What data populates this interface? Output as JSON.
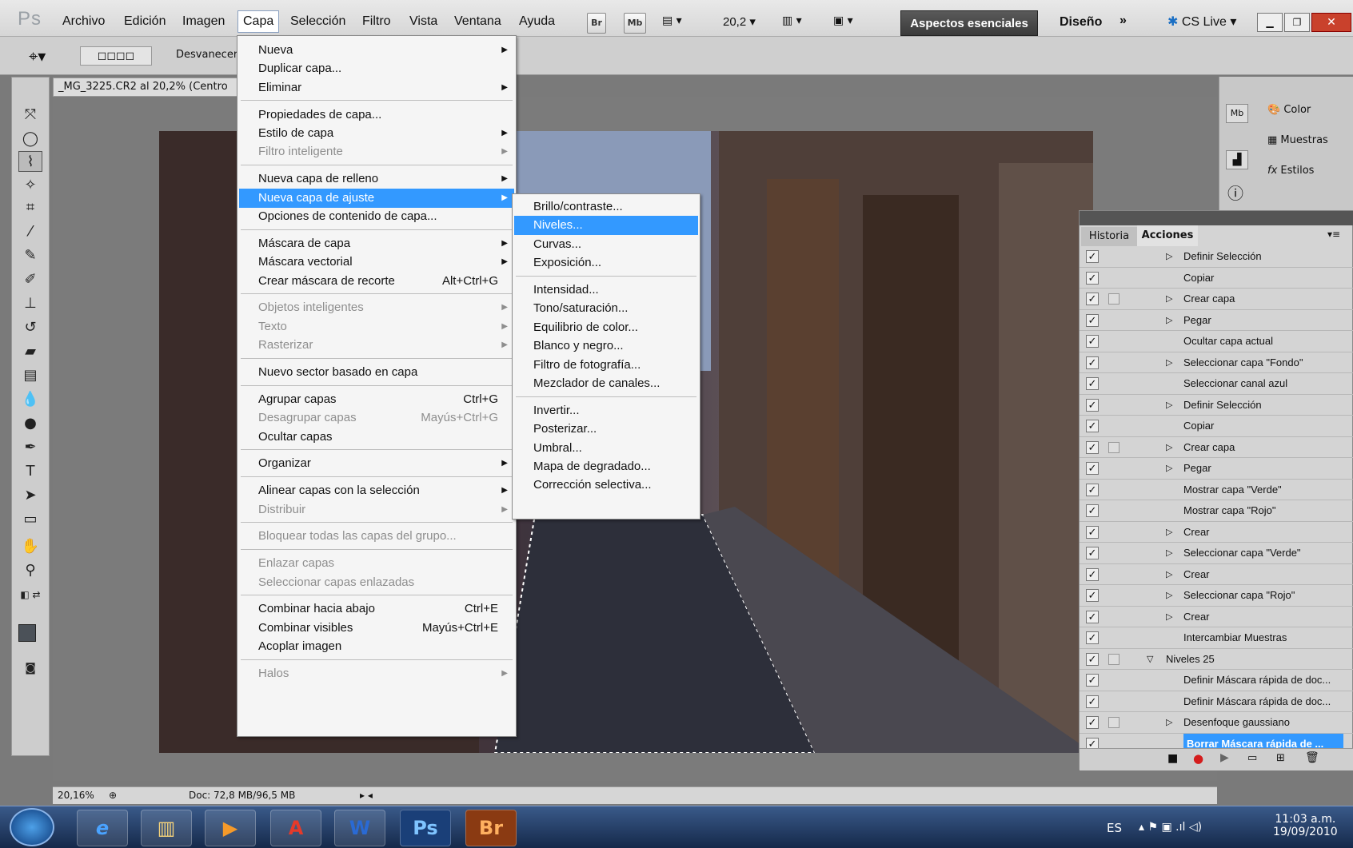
{
  "app": {
    "logo": "Ps"
  },
  "menubar": {
    "items": [
      "Archivo",
      "Edición",
      "Imagen",
      "Capa",
      "Selección",
      "Filtro",
      "Vista",
      "Ventana",
      "Ayuda"
    ],
    "zoom": "20,2",
    "br": "Br",
    "mb": "Mb",
    "workspace": "Aspectos esenciales",
    "design": "Diseño",
    "cslive": "CS Live"
  },
  "options": {
    "label": "Desvanecer:"
  },
  "document": {
    "tab": "_MG_3225.CR2 al 20,2% (Centro",
    "status_zoom": "20,16%",
    "status_doc": "Doc: 72,8 MB/96,5 MB"
  },
  "capa_menu": [
    {
      "label": "Nueva",
      "sub": true
    },
    {
      "label": "Duplicar capa..."
    },
    {
      "label": "Eliminar",
      "sub": true
    },
    {
      "sep": true
    },
    {
      "label": "Propiedades de capa..."
    },
    {
      "label": "Estilo de capa",
      "sub": true
    },
    {
      "label": "Filtro inteligente",
      "sub": true,
      "disabled": true
    },
    {
      "sep": true
    },
    {
      "label": "Nueva capa de relleno",
      "sub": true
    },
    {
      "label": "Nueva capa de ajuste",
      "sub": true,
      "highlight": true
    },
    {
      "label": "Opciones de contenido de capa..."
    },
    {
      "sep": true
    },
    {
      "label": "Máscara de capa",
      "sub": true
    },
    {
      "label": "Máscara vectorial",
      "sub": true
    },
    {
      "label": "Crear máscara de recorte",
      "shortcut": "Alt+Ctrl+G"
    },
    {
      "sep": true
    },
    {
      "label": "Objetos inteligentes",
      "sub": true,
      "disabled": true
    },
    {
      "label": "Texto",
      "sub": true,
      "disabled": true
    },
    {
      "label": "Rasterizar",
      "sub": true,
      "disabled": true
    },
    {
      "sep": true
    },
    {
      "label": "Nuevo sector basado en capa"
    },
    {
      "sep": true
    },
    {
      "label": "Agrupar capas",
      "shortcut": "Ctrl+G"
    },
    {
      "label": "Desagrupar capas",
      "shortcut": "Mayús+Ctrl+G",
      "disabled": true
    },
    {
      "label": "Ocultar capas"
    },
    {
      "sep": true
    },
    {
      "label": "Organizar",
      "sub": true
    },
    {
      "sep": true
    },
    {
      "label": "Alinear capas con la selección",
      "sub": true
    },
    {
      "label": "Distribuir",
      "sub": true,
      "disabled": true
    },
    {
      "sep": true
    },
    {
      "label": "Bloquear todas las capas del grupo...",
      "disabled": true
    },
    {
      "sep": true
    },
    {
      "label": "Enlazar capas",
      "disabled": true
    },
    {
      "label": "Seleccionar capas enlazadas",
      "disabled": true
    },
    {
      "sep": true
    },
    {
      "label": "Combinar hacia abajo",
      "shortcut": "Ctrl+E"
    },
    {
      "label": "Combinar visibles",
      "shortcut": "Mayús+Ctrl+E"
    },
    {
      "label": "Acoplar imagen"
    },
    {
      "sep": true
    },
    {
      "label": "Halos",
      "sub": true,
      "disabled": true
    }
  ],
  "ajuste_menu": [
    {
      "label": "Brillo/contraste..."
    },
    {
      "label": "Niveles...",
      "highlight": true
    },
    {
      "label": "Curvas..."
    },
    {
      "label": "Exposición..."
    },
    {
      "sep": true
    },
    {
      "label": "Intensidad..."
    },
    {
      "label": "Tono/saturación..."
    },
    {
      "label": "Equilibrio de color..."
    },
    {
      "label": "Blanco y negro..."
    },
    {
      "label": "Filtro de fotografía..."
    },
    {
      "label": "Mezclador de canales..."
    },
    {
      "sep": true
    },
    {
      "label": "Invertir..."
    },
    {
      "label": "Posterizar..."
    },
    {
      "label": "Umbral..."
    },
    {
      "label": "Mapa de degradado..."
    },
    {
      "label": "Corrección selectiva..."
    }
  ],
  "dock": {
    "color": "Color",
    "muestras": "Muestras",
    "estilos": "Estilos"
  },
  "panel": {
    "tabs": [
      "Historia",
      "Acciones"
    ],
    "rows": [
      {
        "label": "Definir Selección",
        "tri": true
      },
      {
        "label": "Copiar"
      },
      {
        "label": "Crear capa",
        "tri": true,
        "dlg": true
      },
      {
        "label": "Pegar",
        "tri": true
      },
      {
        "label": "Ocultar capa actual"
      },
      {
        "label": "Seleccionar capa \"Fondo\"",
        "tri": true
      },
      {
        "label": "Seleccionar canal azul"
      },
      {
        "label": "Definir Selección",
        "tri": true
      },
      {
        "label": "Copiar"
      },
      {
        "label": "Crear capa",
        "tri": true,
        "dlg": true
      },
      {
        "label": "Pegar",
        "tri": true
      },
      {
        "label": "Mostrar capa \"Verde\""
      },
      {
        "label": "Mostrar capa \"Rojo\""
      },
      {
        "label": "Crear",
        "tri": true
      },
      {
        "label": "Seleccionar capa \"Verde\"",
        "tri": true
      },
      {
        "label": "Crear",
        "tri": true
      },
      {
        "label": "Seleccionar capa \"Rojo\"",
        "tri": true
      },
      {
        "label": "Crear",
        "tri": true
      },
      {
        "label": "Intercambiar Muestras"
      },
      {
        "label": "Niveles 25",
        "group": true,
        "dlg": true
      },
      {
        "label": "Definir Máscara rápida de doc..."
      },
      {
        "label": "Definir Máscara rápida de doc..."
      },
      {
        "label": "Desenfoque gaussiano",
        "tri": true,
        "dlg": true
      },
      {
        "label": "Borrar Máscara rápida de ...",
        "selected": true
      }
    ]
  },
  "taskbar": {
    "lang": "ES",
    "time": "11:03 a.m.",
    "date": "19/09/2010",
    "ps": "Ps",
    "br": "Br"
  }
}
